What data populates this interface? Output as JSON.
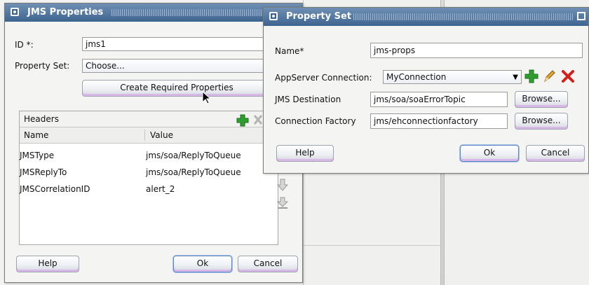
{
  "jms_dialog": {
    "title": "JMS Properties",
    "id_label": "ID *:",
    "id_value": "jms1",
    "property_set_label": "Property Set:",
    "property_set_value": "Choose...",
    "create_button": "Create Required Properties",
    "headers": {
      "title": "Headers",
      "columns": [
        "Name",
        "Value"
      ],
      "rows": [
        {
          "name": "JMSType",
          "value": "jms/soa/ReplyToQueue"
        },
        {
          "name": "JMSReplyTo",
          "value": "jms/soa/ReplyToQueue"
        },
        {
          "name": "JMSCorrelationID",
          "value": "alert_2"
        }
      ]
    },
    "help_button": "Help",
    "ok_button": "Ok",
    "cancel_button": "Cancel"
  },
  "property_set_dialog": {
    "title": "Property Set",
    "name_label": "Name*",
    "name_value": "jms-props",
    "appserver_label": "AppServer Connection:",
    "appserver_value": "MyConnection",
    "destination_label": "JMS Destination",
    "destination_value": "jms/soa/soaErrorTopic",
    "factory_label": "Connection Factory",
    "factory_value": "jms/ehconnectionfactory",
    "browse_label": "Browse...",
    "help_button": "Help",
    "ok_button": "Ok",
    "cancel_button": "Cancel"
  },
  "colors": {
    "title_bar": "#3d6590",
    "add_icon": "#2e9e2e",
    "delete_icon": "#d2201a",
    "edit_icon": "#d99a2b"
  }
}
